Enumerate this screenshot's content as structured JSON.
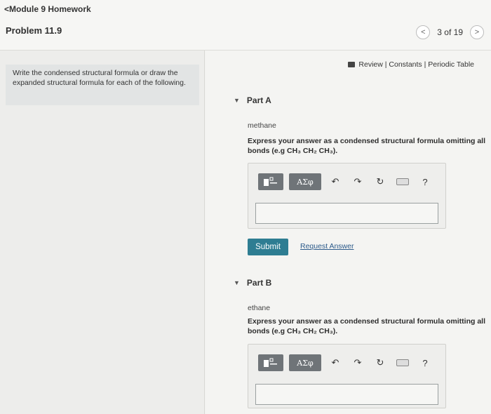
{
  "header": {
    "back_label": "<Module 9 Homework",
    "problem_title": "Problem 11.9",
    "pager_prev": "<",
    "pager_count": "3 of 19",
    "pager_next": ">"
  },
  "left": {
    "prompt": "Write the condensed structural formula or draw the expanded structural formula for each of the following."
  },
  "resources": {
    "label": "Review | Constants | Periodic Table"
  },
  "toolbar": {
    "symbols_label": "ΑΣφ",
    "undo_icon": "↶",
    "redo_icon": "↷",
    "reset_icon": "↻",
    "help_icon": "?"
  },
  "parts": [
    {
      "label": "Part A",
      "compound": "methane",
      "instruction": "Express your answer as a condensed structural formula omitting all bonds (e.g CH₃ CH₂ CH₃).",
      "submit_label": "Submit",
      "request_label": "Request Answer"
    },
    {
      "label": "Part B",
      "compound": "ethane",
      "instruction": "Express your answer as a condensed structural formula omitting all bonds (e.g CH₃ CH₂ CH₃)."
    }
  ],
  "colors": {
    "submit": "#2e7d92",
    "link": "#2c5a8a",
    "toolbar_button": "#6f7478"
  }
}
